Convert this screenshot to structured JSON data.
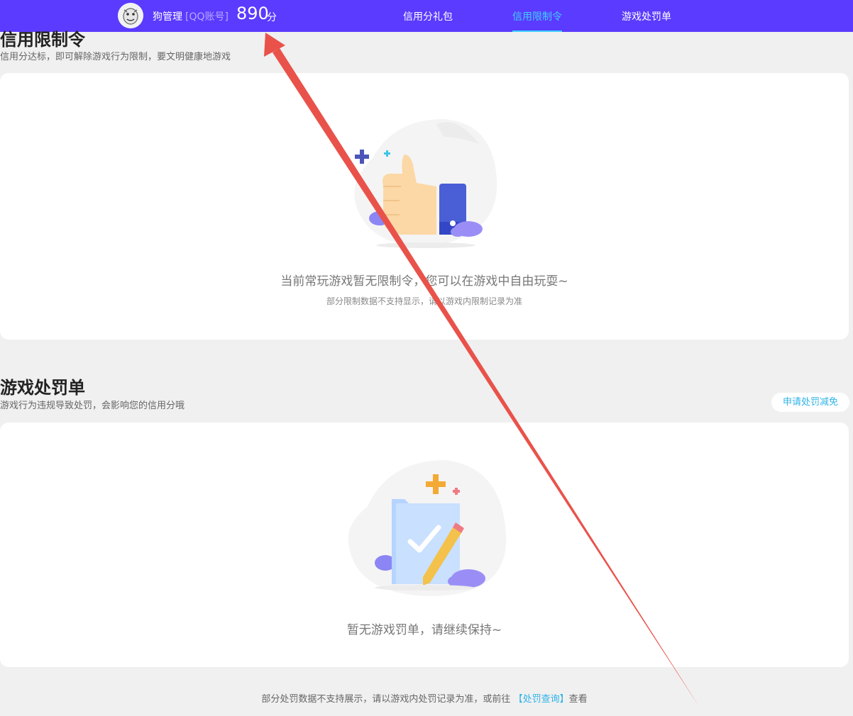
{
  "header": {
    "user_name": "狗管理",
    "account_type": "[QQ账号]",
    "score": "890",
    "score_unit": "分",
    "tabs": [
      {
        "label": "信用分礼包",
        "active": false
      },
      {
        "label": "信用限制令",
        "active": true
      },
      {
        "label": "游戏处罚单",
        "active": false
      }
    ],
    "brand_color": "#5a3bff",
    "active_color": "#3fd0ff"
  },
  "limit_section": {
    "title": "信用限制令",
    "subtitle": "信用分达标，即可解除游戏行为限制，要文明健康地游戏",
    "empty_text": "当前常玩游戏暂无限制令，您可以在游戏中自由玩耍~",
    "note": "部分限制数据不支持显示，请以游戏内限制记录为准",
    "illustration_icon": "thumbs-up-icon"
  },
  "punish_section": {
    "title": "游戏处罚单",
    "subtitle": "游戏行为违规导致处罚，会影响您的信用分哦",
    "apply_button": "申请处罚减免",
    "empty_text": "暂无游戏罚单，请继续保持~",
    "illustration_icon": "checklist-pencil-icon"
  },
  "footer": {
    "note_prefix": "部分处罚数据不支持展示，请以游戏内处罚记录为准，或前往",
    "link_text": "【处罚查询】",
    "note_suffix": "查看"
  },
  "annotation_color": "#e9524a"
}
